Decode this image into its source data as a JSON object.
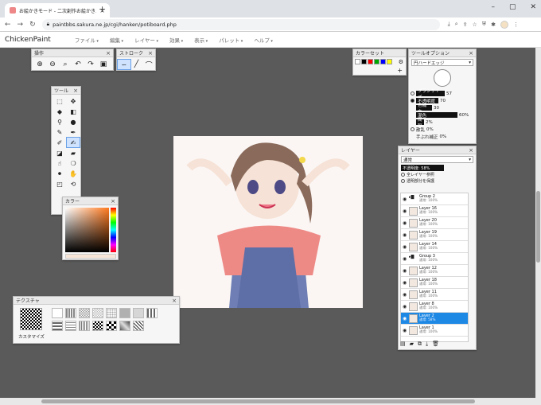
{
  "browser": {
    "tab_title": "お絵かきモード - 二次創作お絵かき…",
    "url": "paintbbs.sakura.ne.jp/cgi/hanken/potiboard.php"
  },
  "app": {
    "brand": "ChickenPaint",
    "menus": [
      "ファイル",
      "編集",
      "レイヤー",
      "効果",
      "表示",
      "パレット",
      "ヘルプ"
    ]
  },
  "panels": {
    "sousa": {
      "title": "操作"
    },
    "stroke": {
      "title": "ストローク"
    },
    "colorset": {
      "title": "カラーセット",
      "colors": [
        "#ffffff",
        "#000000",
        "#ff0000",
        "#00aa00",
        "#0000ff",
        "#ffff00"
      ]
    },
    "tool_options": {
      "title": "ツールオプション",
      "brush": "円ハードエッジ",
      "rows": [
        {
          "label": "ブラシサイズ",
          "value": "57"
        },
        {
          "label": "不透明度",
          "value": "70"
        },
        {
          "label": "色補充",
          "value": "30"
        },
        {
          "label": "混色",
          "value": "60%"
        },
        {
          "label": "間隔",
          "value": "2%"
        },
        {
          "label": "散乱",
          "value": "0%"
        },
        {
          "label": "手ぶれ補正",
          "value": "0%"
        }
      ]
    },
    "tools": {
      "title": "ツール"
    },
    "color": {
      "title": "カラー"
    },
    "texture": {
      "title": "テクスチャ",
      "customize": "カスタマイズ"
    },
    "layers": {
      "title": "レイヤー",
      "blend": "通常",
      "opacity": "不透明度: 58%",
      "check1": "全レイヤー参照",
      "check2": "透明部分を保護",
      "items": [
        {
          "name": "Group 2",
          "sub": "通常: 100%",
          "group": true
        },
        {
          "name": "Layer 16",
          "sub": "通常: 100%"
        },
        {
          "name": "Layer 20",
          "sub": "通常: 100%"
        },
        {
          "name": "Layer 19",
          "sub": "通常: 100%"
        },
        {
          "name": "Layer 14",
          "sub": "通常: 100%"
        },
        {
          "name": "Group 3",
          "sub": "通常: 100%",
          "group": true
        },
        {
          "name": "Layer 12",
          "sub": "通常: 100%"
        },
        {
          "name": "Layer 18",
          "sub": "通常: 100%"
        },
        {
          "name": "Layer 11",
          "sub": "通常: 100%"
        },
        {
          "name": "Layer 8",
          "sub": "通常: 100%"
        },
        {
          "name": "Layer 2",
          "sub": "通常: 58%",
          "active": true
        },
        {
          "name": "Layer 1",
          "sub": "通常: 100%"
        }
      ]
    }
  }
}
